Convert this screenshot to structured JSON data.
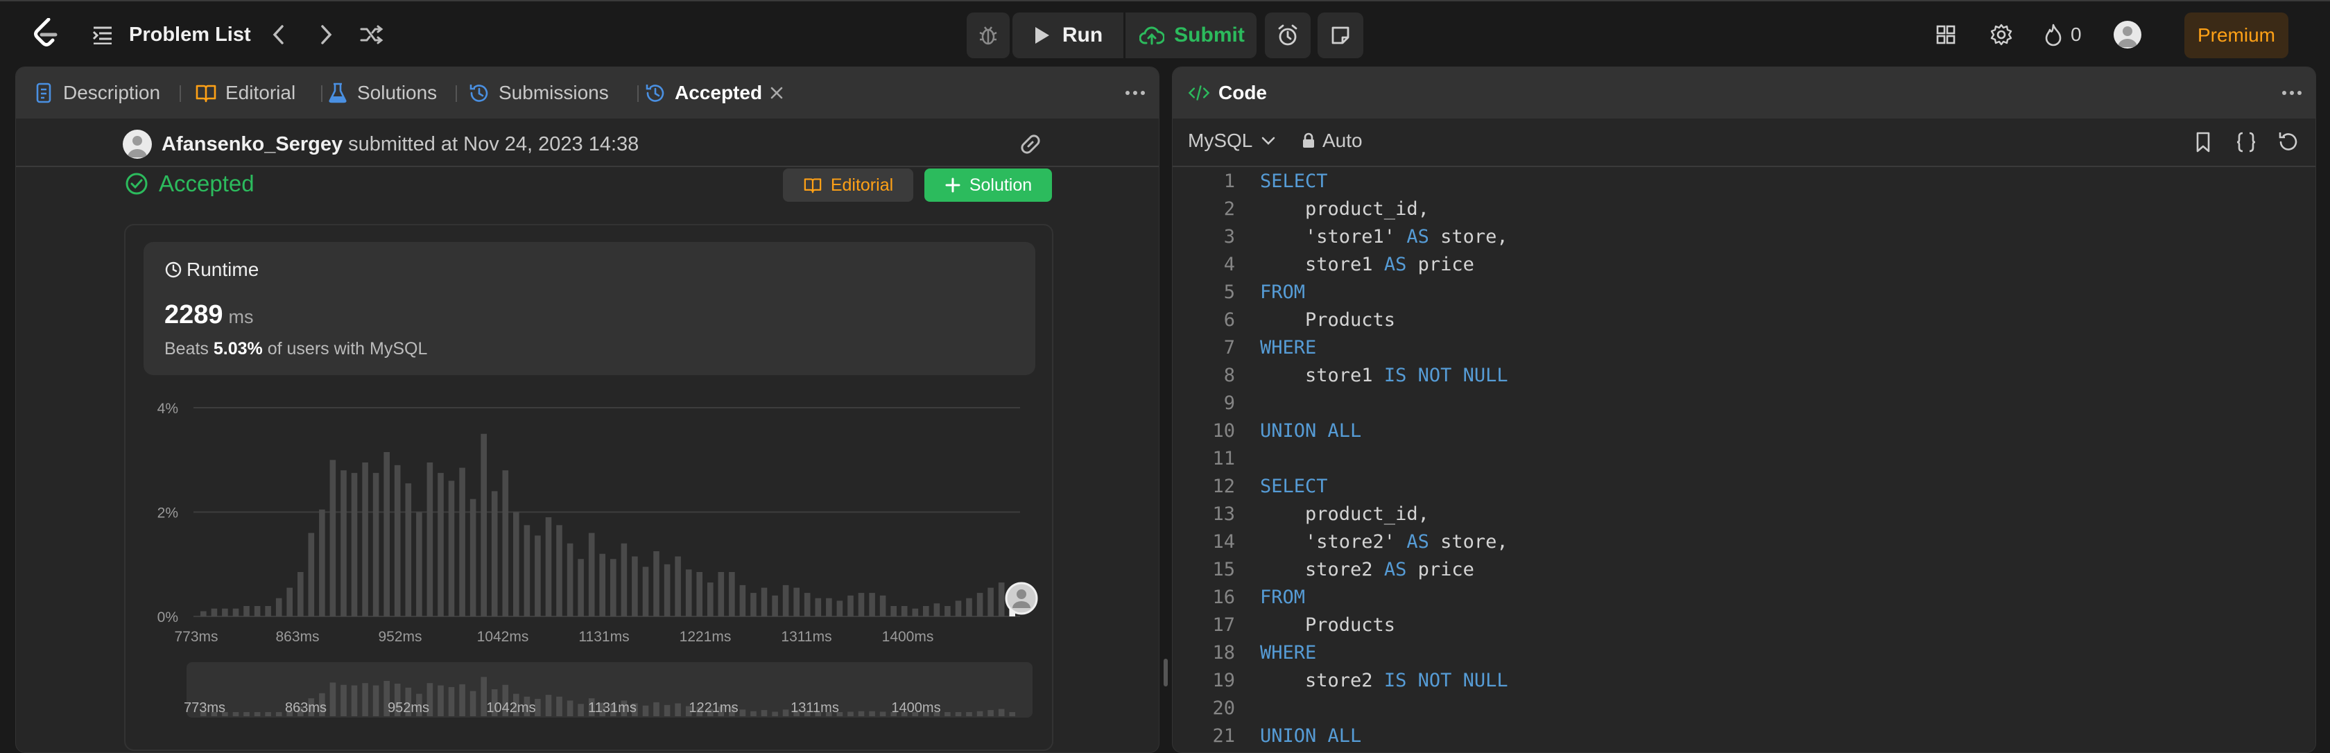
{
  "topbar": {
    "problem_list_label": "Problem List",
    "run_label": "Run",
    "submit_label": "Submit",
    "streak_count": "0",
    "premium_label": "Premium"
  },
  "left_tabs": [
    {
      "label": "Description",
      "icon": "description-icon"
    },
    {
      "label": "Editorial",
      "icon": "book-icon"
    },
    {
      "label": "Solutions",
      "icon": "flask-icon"
    },
    {
      "label": "Submissions",
      "icon": "history-icon"
    },
    {
      "label": "Accepted",
      "icon": "history-icon"
    }
  ],
  "submission": {
    "author": "Afansenko_Sergey",
    "submitted_text": "submitted at Nov 24, 2023 14:38",
    "status": "Accepted",
    "editorial_btn": "Editorial",
    "solution_btn": "Solution"
  },
  "runtime": {
    "title": "Runtime",
    "value": "2289",
    "unit": "ms",
    "beats_prefix": "Beats",
    "beats_pct": "5.03%",
    "beats_suffix": "of users with MySQL"
  },
  "chart_data": {
    "type": "bar",
    "title": "",
    "xlabel": "",
    "ylabel": "",
    "y_ticks": [
      "4%",
      "2%",
      "0%"
    ],
    "ylim": [
      0,
      4.2
    ],
    "x_tick_labels": [
      "773ms",
      "863ms",
      "952ms",
      "1042ms",
      "1131ms",
      "1221ms",
      "1311ms",
      "1400ms"
    ],
    "values": [
      0.1,
      0.15,
      0.15,
      0.15,
      0.2,
      0.2,
      0.2,
      0.35,
      0.55,
      0.85,
      1.6,
      2.05,
      3.0,
      2.8,
      2.75,
      2.95,
      2.75,
      3.15,
      2.9,
      2.55,
      2.0,
      2.95,
      2.75,
      2.6,
      2.85,
      2.25,
      3.5,
      2.4,
      2.8,
      2.0,
      1.75,
      1.55,
      1.9,
      1.75,
      1.4,
      1.1,
      1.6,
      1.2,
      1.1,
      1.4,
      1.15,
      0.95,
      1.25,
      1.0,
      1.15,
      0.9,
      0.85,
      0.65,
      0.85,
      0.85,
      0.6,
      0.45,
      0.55,
      0.4,
      0.6,
      0.55,
      0.45,
      0.35,
      0.35,
      0.3,
      0.4,
      0.45,
      0.45,
      0.4,
      0.2,
      0.2,
      0.15,
      0.2,
      0.25,
      0.2,
      0.3,
      0.35,
      0.45,
      0.55,
      0.65,
      0.15
    ],
    "user_bar_index": 75,
    "grid": true
  },
  "editor": {
    "title": "Code",
    "language": "MySQL",
    "mode": "Auto",
    "lines": [
      {
        "n": "1",
        "tokens": [
          {
            "t": "SELECT",
            "k": true
          }
        ]
      },
      {
        "n": "2",
        "tokens": [
          {
            "t": "    product_id,",
            "k": false
          }
        ]
      },
      {
        "n": "3",
        "tokens": [
          {
            "t": "    'store1' ",
            "k": false
          },
          {
            "t": "AS",
            "k": true
          },
          {
            "t": " store,",
            "k": false
          }
        ]
      },
      {
        "n": "4",
        "tokens": [
          {
            "t": "    store1 ",
            "k": false
          },
          {
            "t": "AS",
            "k": true
          },
          {
            "t": " price",
            "k": false
          }
        ]
      },
      {
        "n": "5",
        "tokens": [
          {
            "t": "FROM",
            "k": true
          }
        ]
      },
      {
        "n": "6",
        "tokens": [
          {
            "t": "    Products",
            "k": false
          }
        ]
      },
      {
        "n": "7",
        "tokens": [
          {
            "t": "WHERE",
            "k": true
          }
        ]
      },
      {
        "n": "8",
        "tokens": [
          {
            "t": "    store1 ",
            "k": false
          },
          {
            "t": "IS NOT NULL",
            "k": true
          }
        ]
      },
      {
        "n": "9",
        "tokens": []
      },
      {
        "n": "10",
        "tokens": [
          {
            "t": "UNION ALL",
            "k": true
          }
        ]
      },
      {
        "n": "11",
        "tokens": []
      },
      {
        "n": "12",
        "tokens": [
          {
            "t": "SELECT",
            "k": true
          }
        ]
      },
      {
        "n": "13",
        "tokens": [
          {
            "t": "    product_id,",
            "k": false
          }
        ]
      },
      {
        "n": "14",
        "tokens": [
          {
            "t": "    'store2' ",
            "k": false
          },
          {
            "t": "AS",
            "k": true
          },
          {
            "t": " store,",
            "k": false
          }
        ]
      },
      {
        "n": "15",
        "tokens": [
          {
            "t": "    store2 ",
            "k": false
          },
          {
            "t": "AS",
            "k": true
          },
          {
            "t": " price",
            "k": false
          }
        ]
      },
      {
        "n": "16",
        "tokens": [
          {
            "t": "FROM",
            "k": true
          }
        ]
      },
      {
        "n": "17",
        "tokens": [
          {
            "t": "    Products",
            "k": false
          }
        ]
      },
      {
        "n": "18",
        "tokens": [
          {
            "t": "WHERE",
            "k": true
          }
        ]
      },
      {
        "n": "19",
        "tokens": [
          {
            "t": "    store2 ",
            "k": false
          },
          {
            "t": "IS NOT NULL",
            "k": true
          }
        ]
      },
      {
        "n": "20",
        "tokens": []
      },
      {
        "n": "21",
        "tokens": [
          {
            "t": "UNION ALL",
            "k": true
          }
        ]
      }
    ]
  },
  "colors": {
    "accent_green": "#2cbb5d",
    "accent_orange": "#ffa116",
    "keyword_blue": "#569cd6"
  }
}
